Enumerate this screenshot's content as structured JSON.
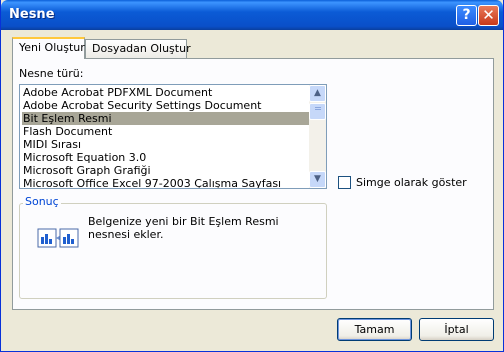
{
  "window": {
    "title": "Nesne",
    "help_label": "?",
    "close_label": "✕"
  },
  "tabs": [
    {
      "label": "Yeni Oluştur",
      "active": true
    },
    {
      "label": "Dosyadan Oluştur",
      "active": false
    }
  ],
  "object_type": {
    "label": "Nesne türü:",
    "items": [
      {
        "label": "Adobe Acrobat PDFXML Document",
        "selected": false
      },
      {
        "label": "Adobe Acrobat Security Settings Document",
        "selected": false
      },
      {
        "label": "Bit Eşlem Resmi",
        "selected": true
      },
      {
        "label": "Flash Document",
        "selected": false
      },
      {
        "label": "MIDI Sırası",
        "selected": false
      },
      {
        "label": "Microsoft Equation 3.0",
        "selected": false
      },
      {
        "label": "Microsoft Graph Grafiği",
        "selected": false
      },
      {
        "label": "Microsoft Office Excel 97-2003 Çalışma Sayfası",
        "selected": false
      }
    ]
  },
  "display_as_icon": {
    "label": "Simge olarak göster",
    "checked": false
  },
  "result": {
    "title": "Sonuç",
    "text": "Belgenize yeni bir Bit Eşlem Resmi nesnesi ekler.",
    "icon": "bitmap-object-icon"
  },
  "buttons": {
    "ok": "Tamam",
    "cancel": "İptal"
  },
  "colors": {
    "selection": "#a8a697",
    "titlebar": "#0a5fd8",
    "group_title": "#0046d5"
  }
}
